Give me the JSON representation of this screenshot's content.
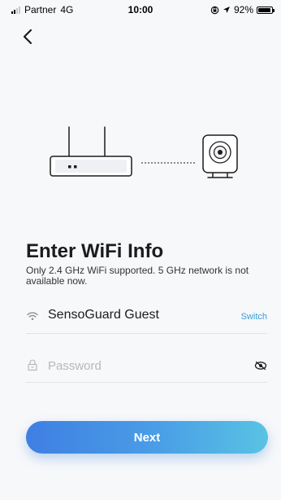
{
  "status_bar": {
    "carrier": "Partner",
    "network": "4G",
    "time": "10:00",
    "battery": "92%",
    "battery_level": 0.92
  },
  "icons": {
    "back": "chevron-left-icon",
    "wifi": "wifi-icon",
    "lock": "lock-icon",
    "eye": "eye-toggle-icon"
  },
  "illustration": {
    "router": "router-icon",
    "camera": "camera-icon"
  },
  "header": {
    "title": "Enter WiFi Info",
    "subtitle": "Only 2.4 GHz WiFi supported. 5 GHz network is not available now."
  },
  "wifi_form": {
    "ssid": "SensoGuard Guest",
    "switch_label": "Switch",
    "password_value": "",
    "password_placeholder": "Password"
  },
  "actions": {
    "next_label": "Next"
  },
  "colors": {
    "background": "#f7f8fa",
    "accent": "#3a9ddc",
    "button_start": "#3f7fe3",
    "button_end": "#58c3e3"
  }
}
